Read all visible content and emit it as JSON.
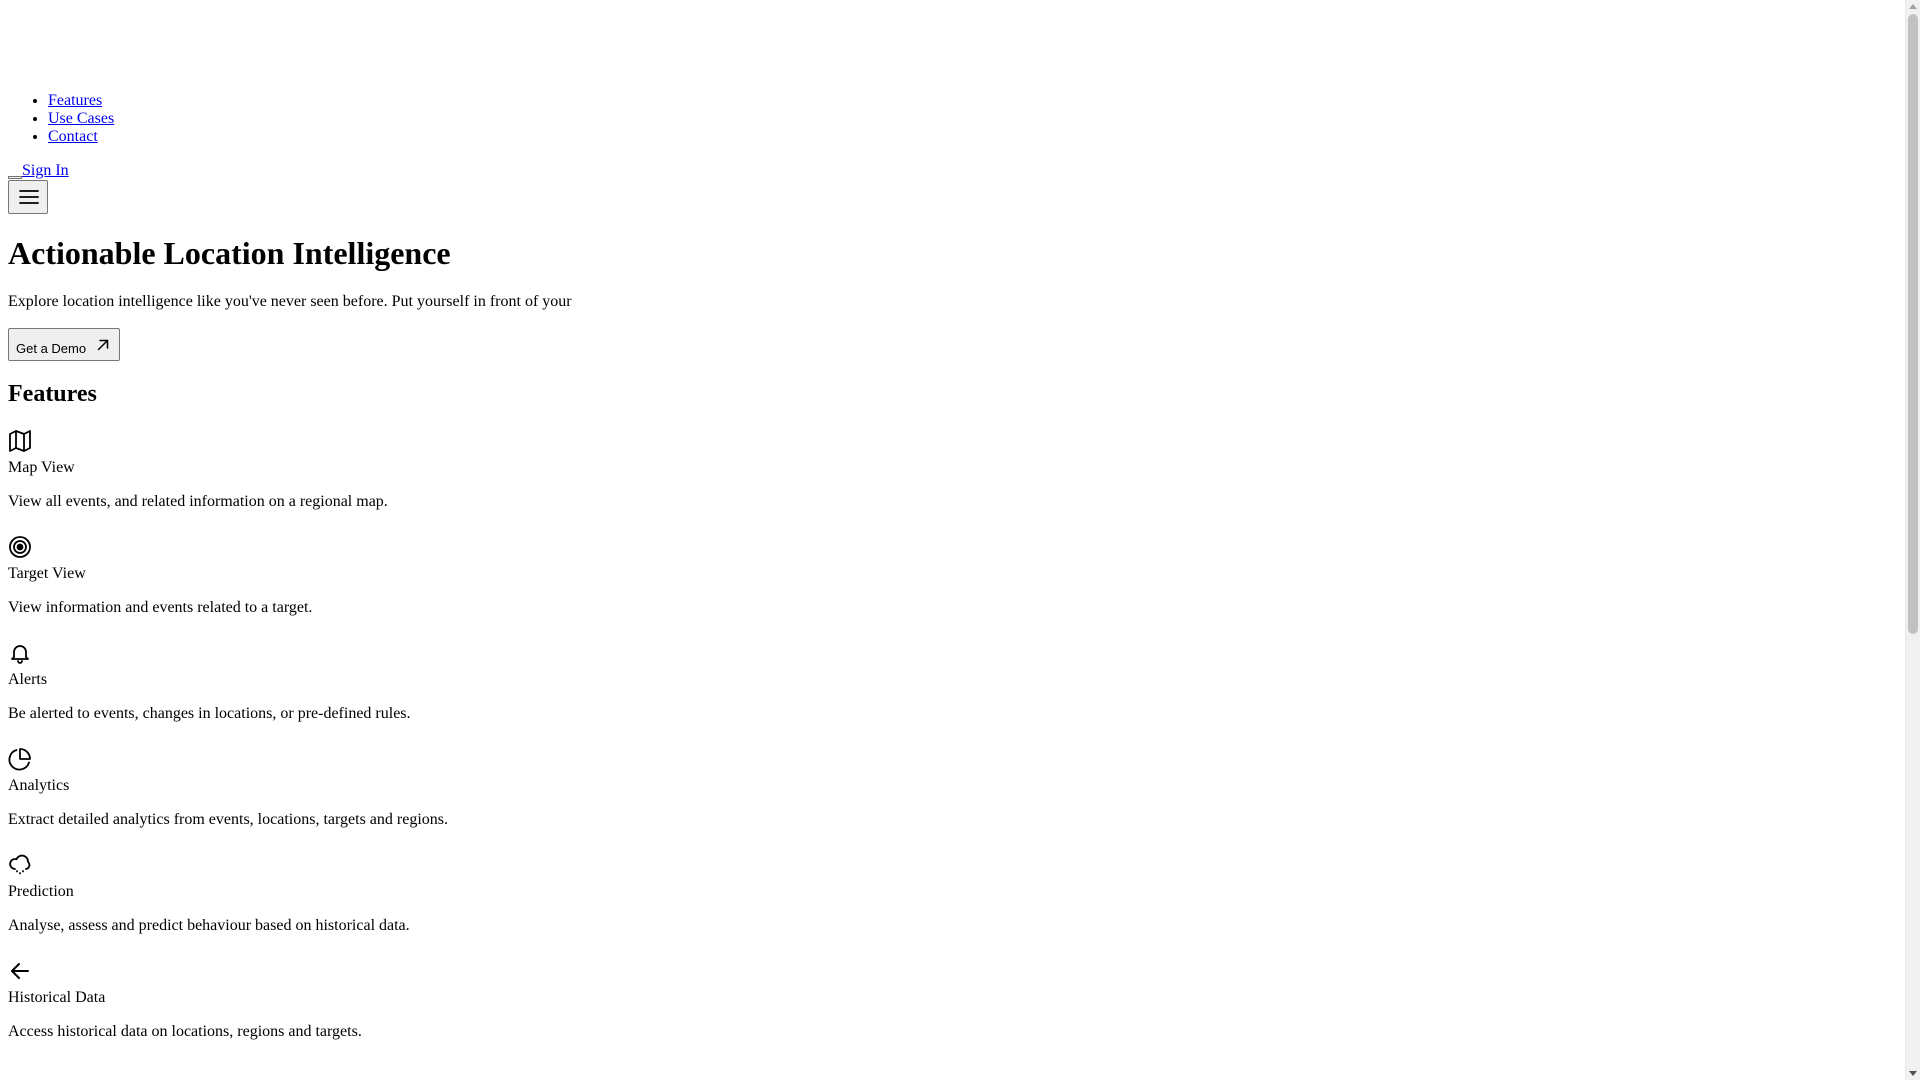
{
  "nav": {
    "items": [
      {
        "label": "Features"
      },
      {
        "label": "Use Cases"
      },
      {
        "label": "Contact"
      }
    ],
    "sign_in_label": "Sign In",
    "menu_icon": "hamburger-menu-icon"
  },
  "hero": {
    "title": "Actionable Location Intelligence",
    "description": "Explore location intelligence like you've never seen before. Put yourself in front of your",
    "cta_label": "Get a Demo",
    "cta_icon": "arrow-up-right-icon"
  },
  "features": {
    "title": "Features",
    "items": [
      {
        "icon": "map-icon",
        "name": "Map View",
        "description": "View all events, and related information on a regional map."
      },
      {
        "icon": "target-icon",
        "name": "Target View",
        "description": "View information and events related to a target."
      },
      {
        "icon": "bell-icon",
        "name": "Alerts",
        "description": "Be alerted to events, changes in locations, or pre-defined rules."
      },
      {
        "icon": "pie-chart-icon",
        "name": "Analytics",
        "description": "Extract detailed analytics from events, locations, targets and regions."
      },
      {
        "icon": "cloud-rain-icon",
        "name": "Prediction",
        "description": "Analyse, assess and predict behaviour based on historical data."
      },
      {
        "icon": "arrow-left-icon",
        "name": "Historical Data",
        "description": "Access historical data on locations, regions and targets."
      }
    ]
  },
  "colors": {
    "link": "#0000ee",
    "text": "#000000",
    "button_bg": "#efefef",
    "button_border": "#767676"
  }
}
